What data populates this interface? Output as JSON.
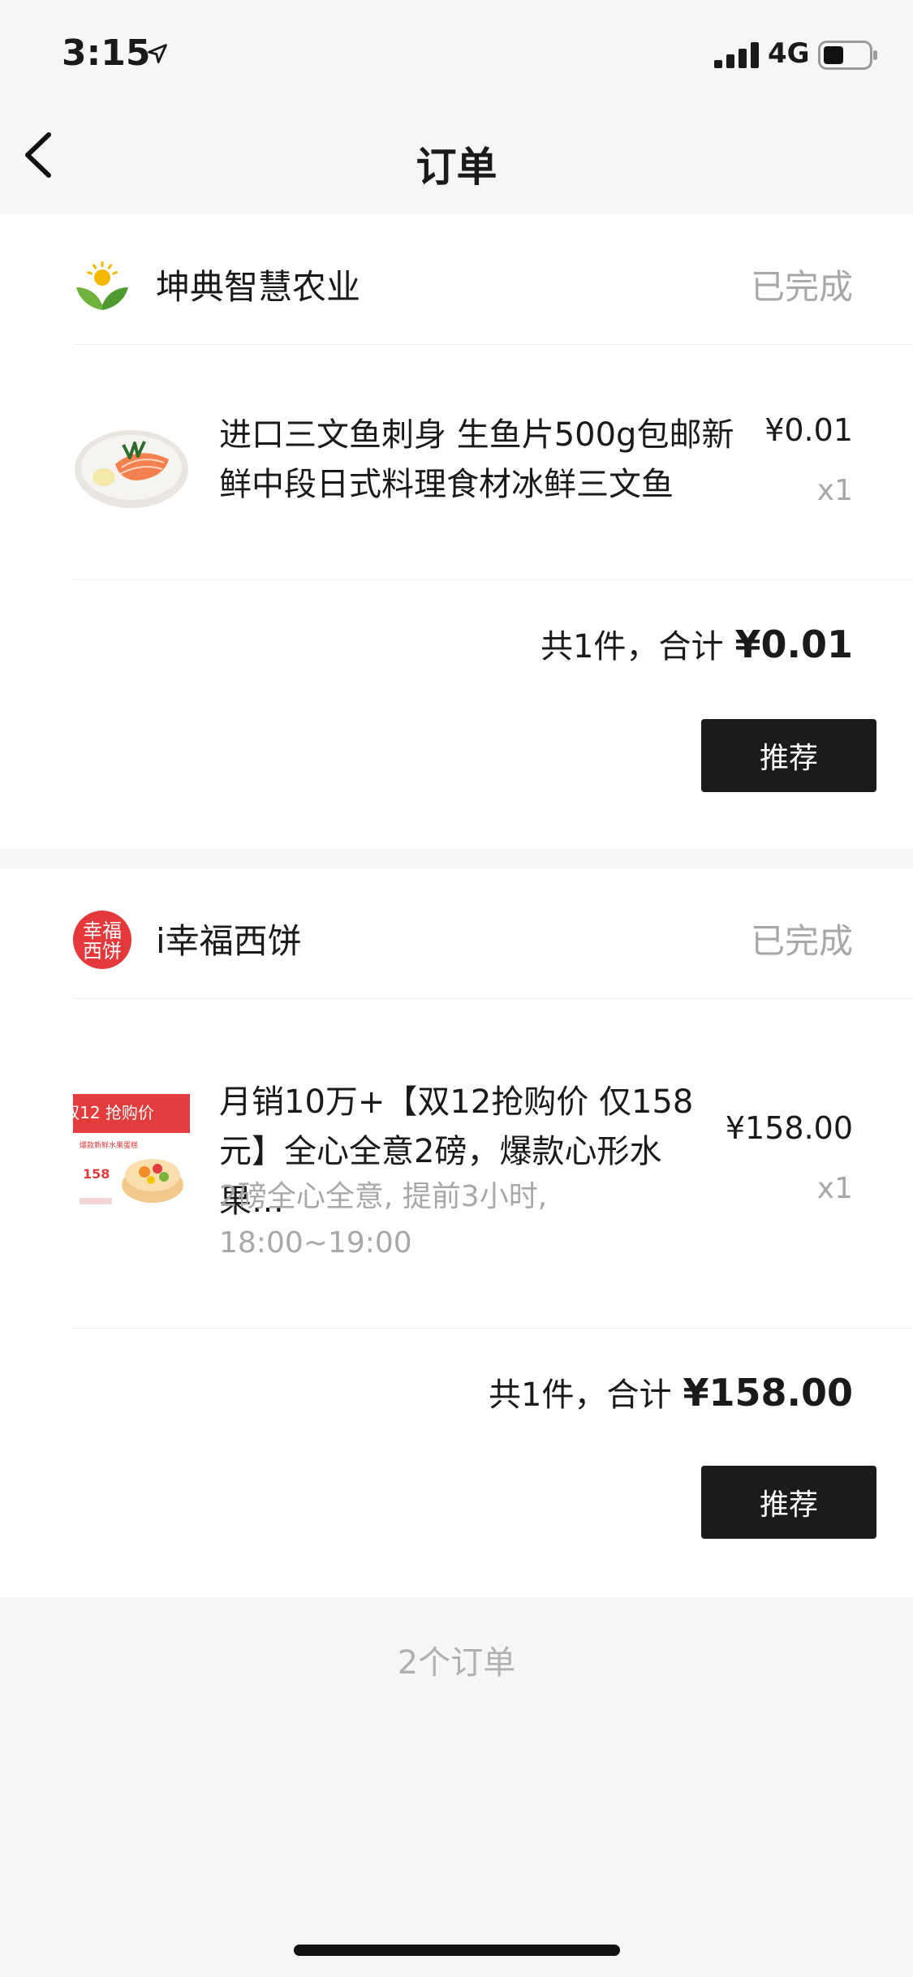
{
  "status_bar": {
    "time": "3:15",
    "network": "4G",
    "icons": [
      "location-arrow-icon",
      "signal-bars-icon",
      "battery-icon"
    ]
  },
  "nav": {
    "title": "订单",
    "back_icon": "chevron-left-icon"
  },
  "orders": [
    {
      "store": {
        "name": "坤典智慧农业",
        "logo": "sun-sprout-logo"
      },
      "status": "已完成",
      "product": {
        "title": "进口三文鱼刺身 生鱼片500g包邮新鲜中段日式料理食材冰鲜三文鱼",
        "spec": "",
        "price": "¥0.01",
        "qty": "x1",
        "thumb": "salmon-sashimi-image"
      },
      "total_prefix": "共1件，合计",
      "total_amount": "¥0.01",
      "action_label": "推荐"
    },
    {
      "store": {
        "name": "i幸福西饼",
        "logo_text": [
          "幸福",
          "西饼"
        ],
        "logo": "xingfu-xibing-logo"
      },
      "status": "已完成",
      "product": {
        "title": "月销10万+【双12抢购价 仅158元】全心全意2磅，爆款心形水果…",
        "spec": "2磅全心全意, 提前3小时, 18:00~19:00",
        "price": "¥158.00",
        "qty": "x1",
        "thumb": "fruit-cake-image",
        "thumb_text": {
          "headline": "双12 抢购价",
          "caption": "爆款新鲜水果蛋糕",
          "price": "158"
        }
      },
      "total_prefix": "共1件，合计",
      "total_amount": "¥158.00",
      "action_label": "推荐"
    }
  ],
  "footer": {
    "order_count": "2个订单"
  },
  "colors": {
    "background": "#f6f6f6",
    "card": "#ffffff",
    "primary_text": "#1a1a1a",
    "secondary_text": "#a8a8a8",
    "button": "#1b1b1b",
    "brand_red": "#e5383b",
    "logo_green": "#5fae3a",
    "logo_yellow": "#f5b800"
  }
}
